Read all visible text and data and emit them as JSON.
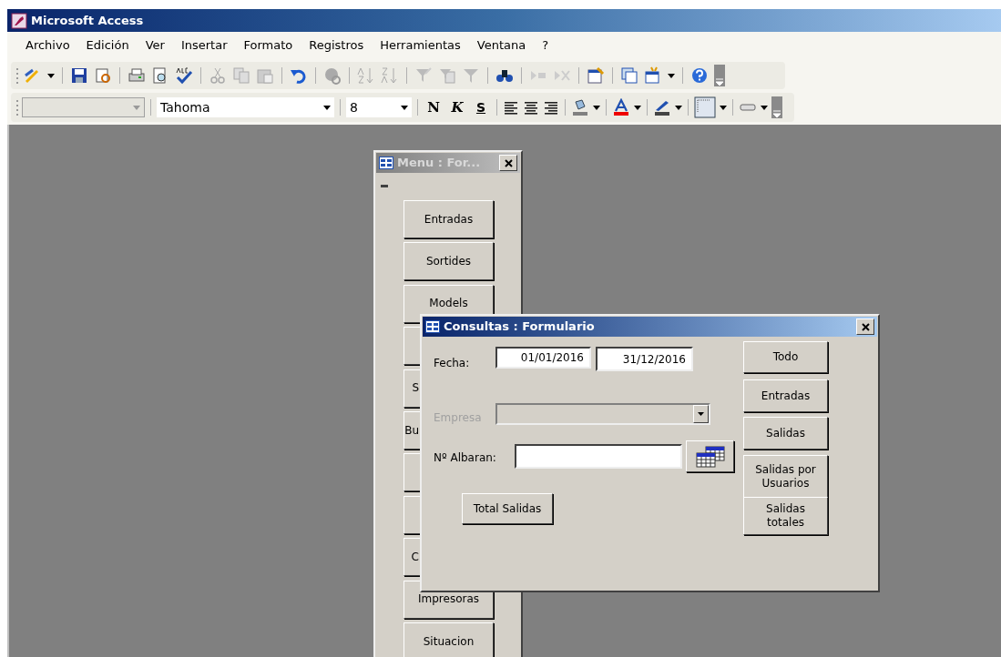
{
  "app_window": {
    "title": "Microsoft Access"
  },
  "menu_bar": [
    "Archivo",
    "Edición",
    "Ver",
    "Insertar",
    "Formato",
    "Registros",
    "Herramientas",
    "Ventana",
    "?"
  ],
  "format_toolbar": {
    "object_combo": {
      "disabled": true
    },
    "font": "Tahoma",
    "size": "8",
    "bold": "N",
    "italic": "K",
    "underline": "S"
  },
  "menu_form": {
    "title": "Menu : For...",
    "active": false,
    "buttons": [
      {
        "label": "Entradas"
      },
      {
        "label": "Sortides"
      },
      {
        "label": "Models"
      },
      {
        "covered": true
      },
      {
        "label": "S",
        "covered": true
      },
      {
        "label": "Bu",
        "covered": true
      },
      {
        "covered": true
      },
      {
        "covered": true
      },
      {
        "label": "C",
        "covered": true
      },
      {
        "label": "Impresoras"
      },
      {
        "label": "Situacion"
      }
    ]
  },
  "consultas_form": {
    "title": "Consultas : Formulario",
    "active": true,
    "fecha_label": "Fecha:",
    "date_from": "01/01/2016",
    "date_to": "31/12/2016",
    "empresa": {
      "label": "Empresa",
      "disabled": true
    },
    "albaran_label": "Nº Albaran:",
    "total_button": "Total Salidas",
    "side_buttons": [
      "Todo",
      "Entradas",
      "Salidas",
      "Salidas por Usuarios",
      "Salidas totales"
    ]
  }
}
